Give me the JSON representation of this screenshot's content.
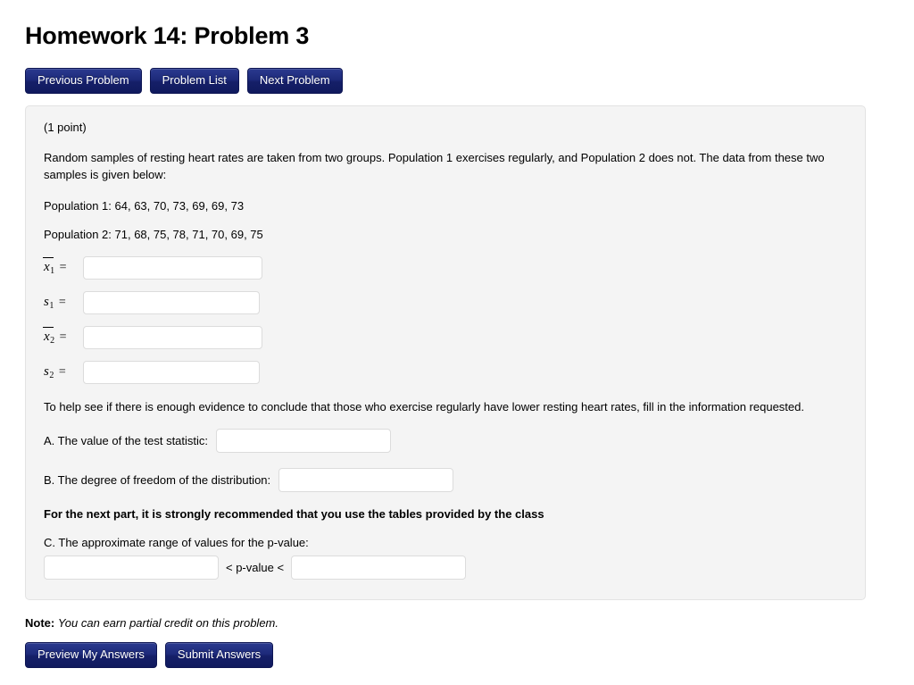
{
  "page_title": "Homework 14: Problem 3",
  "nav_buttons": [
    {
      "label": "Previous Problem",
      "name": "previous-problem-button"
    },
    {
      "label": "Problem List",
      "name": "problem-list-button"
    },
    {
      "label": "Next Problem",
      "name": "next-problem-button"
    }
  ],
  "problem": {
    "points": "(1 point)",
    "description": "Random samples of resting heart rates are taken from two groups. Population 1 exercises regularly, and Population 2 does not. The data from these two samples is given below:",
    "population_1": "Population 1: 64, 63, 70, 73, 69, 69, 73",
    "population_2": "Population 2: 71, 68, 75, 78, 71, 70, 69, 75",
    "stats": [
      {
        "symbol": "x",
        "overbar": true,
        "subscript": "1",
        "equals": "=",
        "value": "",
        "placeholder": ""
      },
      {
        "symbol": "s",
        "overbar": false,
        "subscript": "1",
        "equals": "=",
        "value": "",
        "placeholder": ""
      },
      {
        "symbol": "x",
        "overbar": true,
        "subscript": "2",
        "equals": "=",
        "value": "",
        "placeholder": ""
      },
      {
        "symbol": "s",
        "overbar": false,
        "subscript": "2",
        "equals": "=",
        "value": "",
        "placeholder": ""
      }
    ],
    "help_line": "To help see if there is enough evidence to conclude that those who exercise regularly have lower resting heart rates, fill in the information requested.",
    "part_a_label": "A. The value of the test statistic:",
    "part_a_value": "",
    "part_b_label": "B. The degree of freedom of the distribution:",
    "part_b_value": "",
    "recommendation": "For the next part, it is strongly recommended that you use the tables provided by the class",
    "part_c_label": "C. The approximate range of values for the p-value:",
    "part_c_lower_value": "",
    "part_c_upper_value": "",
    "pvalue_separator": "< p-value <"
  },
  "footer": {
    "note_prefix": "Note:",
    "note_text": "You can earn partial credit on this problem.",
    "buttons": [
      {
        "label": "Preview My Answers",
        "name": "preview-my-answers-button"
      },
      {
        "label": "Submit Answers",
        "name": "submit-answers-button"
      }
    ]
  },
  "colors": {
    "button_blue": "#1d2a7a",
    "panel_background": "#f4f4f4",
    "panel_border": "#e3e3e3",
    "input_border": "#dcdcdc"
  }
}
